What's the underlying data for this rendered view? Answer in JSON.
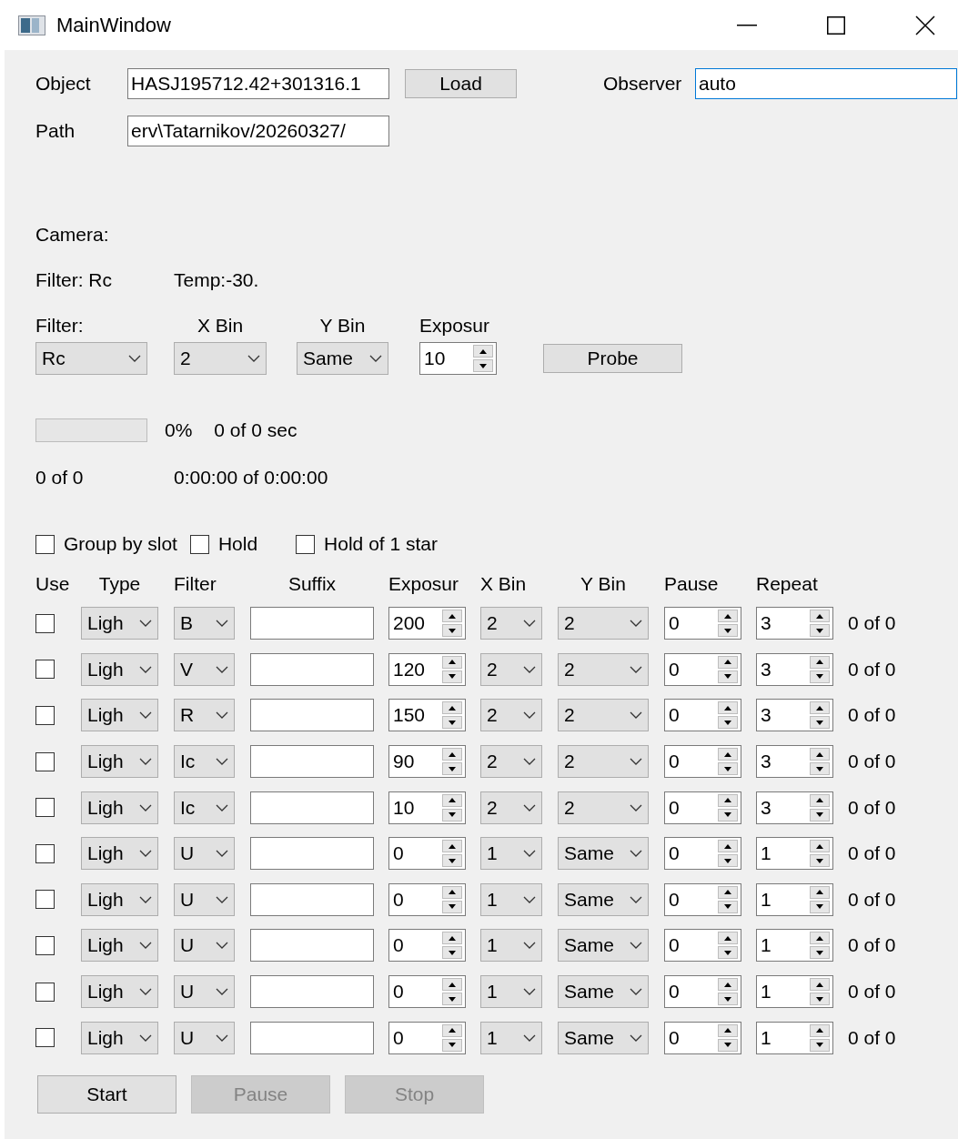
{
  "window": {
    "title": "MainWindow"
  },
  "object": {
    "label": "Object",
    "value": "HASJ195712.42+301316.1"
  },
  "load_button": {
    "label": "Load"
  },
  "observer": {
    "label": "Observer",
    "value": "auto",
    "focused": true
  },
  "path": {
    "label": "Path",
    "value": "erv\\Tatarnikov/20260327/"
  },
  "camera": {
    "label": "Camera:"
  },
  "camera_status": {
    "filter": "Filter:  Rc",
    "temp": "Temp:-30."
  },
  "settings": [
    {
      "kind": "combo",
      "label": "Filter:",
      "value": "Rc"
    },
    {
      "kind": "combo",
      "label": "X Bin",
      "value": "2"
    },
    {
      "kind": "combo",
      "label": "Y Bin",
      "value": "Same"
    },
    {
      "kind": "spin",
      "label": "Exposur",
      "value": "10"
    }
  ],
  "probe_button": {
    "label": "Probe"
  },
  "progress": {
    "level": 0,
    "percent": "0%",
    "seconds": "0 of 0 sec"
  },
  "totals": {
    "frames": "0 of 0",
    "time": "0:00:00 of 0:00:00"
  },
  "options": [
    {
      "label": "Group by slot",
      "checked": false
    },
    {
      "label": "Hold",
      "checked": false
    },
    {
      "label": "Hold of 1 star",
      "checked": false
    }
  ],
  "table": {
    "columns": [
      "Use",
      "Type",
      "Filter",
      "Suffix",
      "Exposur",
      "X Bin",
      "Y Bin",
      "Pause",
      "Repeat"
    ],
    "rows": [
      {
        "use": false,
        "type": "Ligh",
        "filter": "B",
        "exposure": "200",
        "x_bin": "2",
        "y_bin": "2",
        "pause": "0",
        "repeat": "3",
        "done": "0 of 0"
      },
      {
        "use": false,
        "type": "Ligh",
        "filter": "V",
        "exposure": "120",
        "x_bin": "2",
        "y_bin": "2",
        "pause": "0",
        "repeat": "3",
        "done": "0 of 0"
      },
      {
        "use": false,
        "type": "Ligh",
        "filter": "R",
        "exposure": "150",
        "x_bin": "2",
        "y_bin": "2",
        "pause": "0",
        "repeat": "3",
        "done": "0 of 0"
      },
      {
        "use": false,
        "type": "Ligh",
        "filter": "Ic",
        "exposure": "90",
        "x_bin": "2",
        "y_bin": "2",
        "pause": "0",
        "repeat": "3",
        "done": "0 of 0"
      },
      {
        "use": false,
        "type": "Ligh",
        "filter": "Ic",
        "exposure": "10",
        "x_bin": "2",
        "y_bin": "2",
        "pause": "0",
        "repeat": "3",
        "done": "0 of 0"
      },
      {
        "use": false,
        "type": "Ligh",
        "filter": "U",
        "exposure": "0",
        "x_bin": "1",
        "y_bin": "Same",
        "pause": "0",
        "repeat": "1",
        "done": "0 of 0"
      },
      {
        "use": false,
        "type": "Ligh",
        "filter": "U",
        "exposure": "0",
        "x_bin": "1",
        "y_bin": "Same",
        "pause": "0",
        "repeat": "1",
        "done": "0 of 0"
      },
      {
        "use": false,
        "type": "Ligh",
        "filter": "U",
        "exposure": "0",
        "x_bin": "1",
        "y_bin": "Same",
        "pause": "0",
        "repeat": "1",
        "done": "0 of 0"
      },
      {
        "use": false,
        "type": "Ligh",
        "filter": "U",
        "exposure": "0",
        "x_bin": "1",
        "y_bin": "Same",
        "pause": "0",
        "repeat": "1",
        "done": "0 of 0"
      },
      {
        "use": false,
        "type": "Ligh",
        "filter": "U",
        "exposure": "0",
        "x_bin": "1",
        "y_bin": "Same",
        "pause": "0",
        "repeat": "1",
        "done": "0 of 0"
      }
    ]
  },
  "buttons": [
    {
      "label": "Start",
      "disabled": false
    },
    {
      "label": "Pause",
      "disabled": true
    },
    {
      "label": "Stop",
      "disabled": true
    }
  ]
}
